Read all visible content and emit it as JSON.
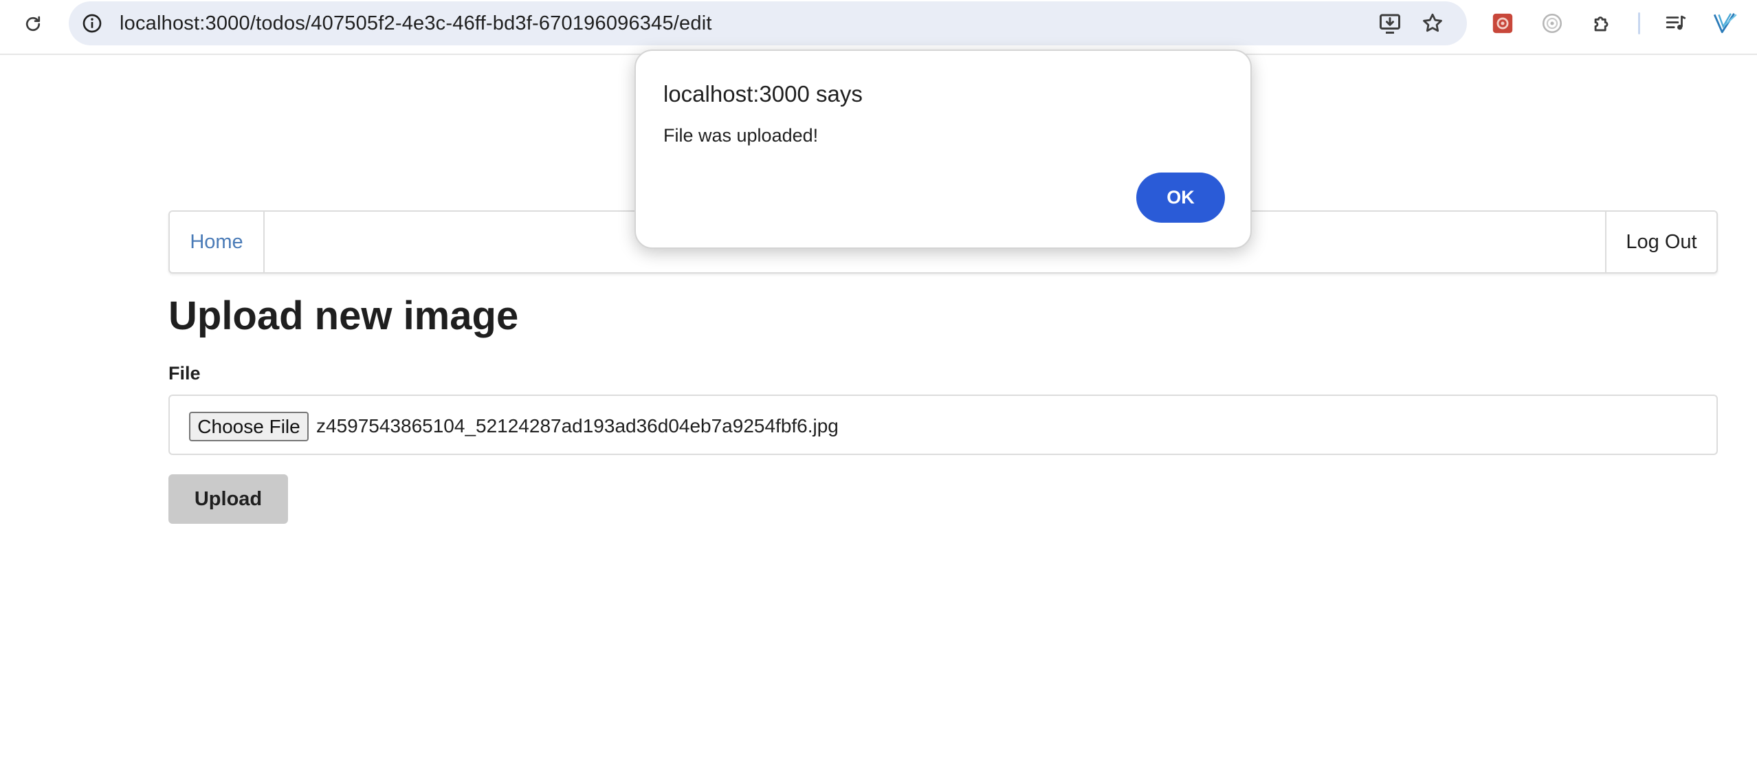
{
  "browser": {
    "url": "localhost:3000/todos/407505f2-4e3c-46ff-bd3f-670196096345/edit",
    "icons": {
      "reload": "reload-icon",
      "site_info": "info-icon",
      "install": "install-app-icon",
      "bookmark": "star-icon",
      "ext1": "red-extension-icon",
      "ext2": "gray-extension-icon",
      "extensions": "puzzle-icon",
      "media": "media-control-icon",
      "profile": "v-logo-icon"
    }
  },
  "nav": {
    "home": "Home",
    "logout": "Log Out"
  },
  "page": {
    "title": "Upload new image",
    "file_label": "File",
    "choose_file": "Choose File",
    "file_name": "z4597543865104_52124287ad193ad36d04eb7a9254fbf6.jpg",
    "upload": "Upload"
  },
  "dialog": {
    "title": "localhost:3000 says",
    "message": "File was uploaded!",
    "ok": "OK"
  },
  "colors": {
    "link": "#4a7bb7",
    "ok_button": "#2a5bd7",
    "upload_button": "#cacaca",
    "omnibox": "#e9edf6"
  }
}
